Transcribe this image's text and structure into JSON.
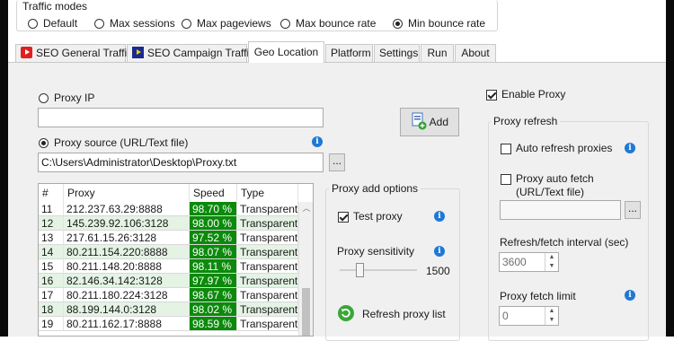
{
  "traffic_modes": {
    "title": "Traffic modes",
    "options": [
      {
        "label": "Default",
        "selected": false
      },
      {
        "label": "Max sessions",
        "selected": false
      },
      {
        "label": "Max pageviews",
        "selected": false
      },
      {
        "label": "Max bounce rate",
        "selected": false
      },
      {
        "label": "Min bounce rate",
        "selected": true
      }
    ]
  },
  "tabs": [
    {
      "label": "SEO General Traffic",
      "icon": "youtube-icon",
      "active": false
    },
    {
      "label": "SEO Campaign Traffic",
      "icon": "play-icon",
      "active": false
    },
    {
      "label": "Geo Location",
      "active": true
    },
    {
      "label": "Platform",
      "active": false
    },
    {
      "label": "Settings",
      "active": false
    },
    {
      "label": "Run",
      "active": false
    },
    {
      "label": "About",
      "active": false
    }
  ],
  "proxy": {
    "proxy_ip_label": "Proxy IP",
    "proxy_ip_selected": false,
    "proxy_ip_value": "",
    "add_button": "Add",
    "source_label": "Proxy source (URL/Text file)",
    "source_selected": true,
    "source_path": "C:\\Users\\Administrator\\Desktop\\Proxy.txt",
    "browse_label": "..."
  },
  "proxy_table": {
    "headers": [
      "#",
      "Proxy",
      "Speed",
      "Type"
    ],
    "rows": [
      {
        "num": "11",
        "proxy": "212.237.63.29:8888",
        "speed": "98.70 %",
        "type": "Transparent"
      },
      {
        "num": "12",
        "proxy": "145.239.92.106:3128",
        "speed": "98.00 %",
        "type": "Transparent"
      },
      {
        "num": "13",
        "proxy": "217.61.15.26:3128",
        "speed": "97.52 %",
        "type": "Transparent"
      },
      {
        "num": "14",
        "proxy": "80.211.154.220:8888",
        "speed": "98.07 %",
        "type": "Transparent"
      },
      {
        "num": "15",
        "proxy": "80.211.148.20:8888",
        "speed": "98.11 %",
        "type": "Transparent"
      },
      {
        "num": "16",
        "proxy": "82.146.34.142:3128",
        "speed": "97.97 %",
        "type": "Transparent"
      },
      {
        "num": "17",
        "proxy": "80.211.180.224:3128",
        "speed": "98.67 %",
        "type": "Transparent"
      },
      {
        "num": "18",
        "proxy": "88.199.144.0:3128",
        "speed": "98.02 %",
        "type": "Transparent"
      },
      {
        "num": "19",
        "proxy": "80.211.162.17:8888",
        "speed": "98.59 %",
        "type": "Transparent"
      }
    ],
    "speed_color": "#0b8a0b",
    "alt_row_color": "#e4f3e4",
    "scroll_up_arrow": "︿"
  },
  "proxy_add_options": {
    "title": "Proxy add options",
    "test_proxy_label": "Test proxy",
    "test_proxy_checked": true,
    "sensitivity_label": "Proxy sensitivity",
    "sensitivity_value": "1500",
    "refresh_label": "Refresh proxy list"
  },
  "right_panel": {
    "enable_proxy_label": "Enable Proxy",
    "enable_proxy_checked": true,
    "refresh_group_title": "Proxy refresh",
    "auto_refresh_label": "Auto refresh proxies",
    "auto_refresh_checked": false,
    "auto_fetch_label_1": "Proxy auto fetch",
    "auto_fetch_label_2": "(URL/Text file)",
    "auto_fetch_checked": false,
    "auto_fetch_value": "",
    "interval_label": "Refresh/fetch interval (sec)",
    "interval_value": "3600",
    "fetch_limit_label": "Proxy fetch limit",
    "fetch_limit_value": "0"
  },
  "info_icon_glyph": "i"
}
